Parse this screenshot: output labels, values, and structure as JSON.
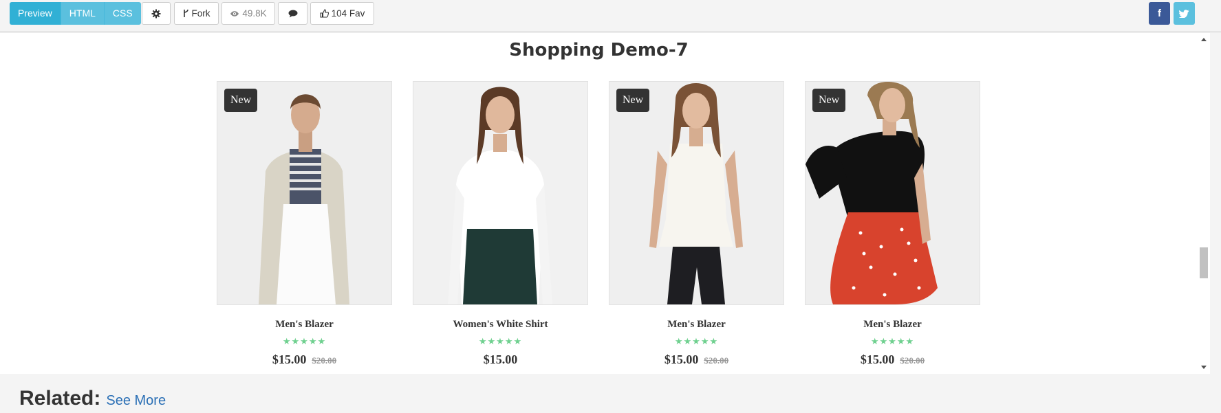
{
  "toolbar": {
    "tabs": [
      {
        "label": "Preview"
      },
      {
        "label": "HTML"
      },
      {
        "label": "CSS"
      }
    ],
    "settings_icon": "gear-icon",
    "fork_label": "Fork",
    "views_label": "49.8K",
    "comment_icon": "comment-icon",
    "fav_label": "104 Fav",
    "social": {
      "facebook": "f",
      "twitter": "twitter-icon"
    }
  },
  "preview": {
    "title": "Shopping Demo-7",
    "products": [
      {
        "name": "Men's Blazer",
        "badge": "New",
        "stars": "★★★★★",
        "rating": 5,
        "price": "$15.00",
        "old_price": "$20.00"
      },
      {
        "name": "Women's White Shirt",
        "badge": "",
        "stars": "★★★★★",
        "rating": 5,
        "price": "$15.00",
        "old_price": ""
      },
      {
        "name": "Men's Blazer",
        "badge": "New",
        "stars": "★★★★★",
        "rating": 5,
        "price": "$15.00",
        "old_price": "$20.00"
      },
      {
        "name": "Men's Blazer",
        "badge": "New",
        "stars": "★★★★★",
        "rating": 5,
        "price": "$15.00",
        "old_price": "$20.00"
      }
    ]
  },
  "related": {
    "heading": "Related:",
    "link": "See More"
  },
  "colors": {
    "accent": "#31b0d5",
    "tab": "#5bc0de",
    "star": "#6fd08f",
    "facebook": "#3b5998",
    "link": "#2a6fb5"
  }
}
